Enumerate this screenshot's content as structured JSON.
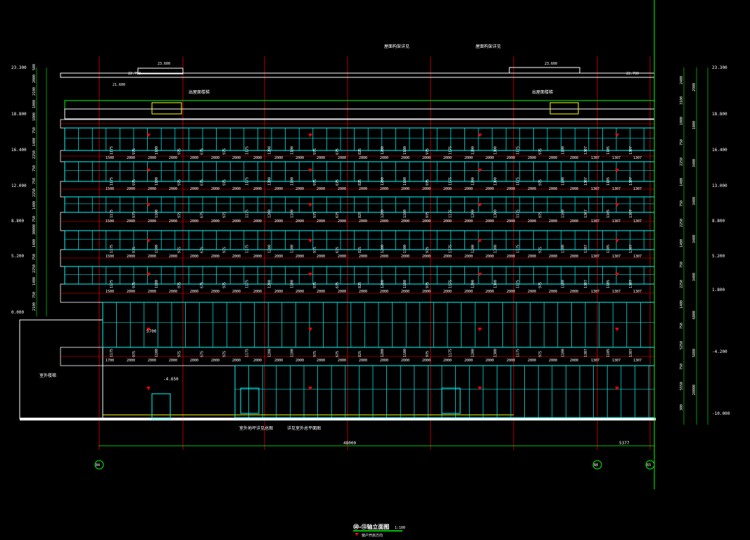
{
  "drawing": {
    "title": "㊿-⑬轴立面图",
    "scale": "1:100",
    "legend_note": "窗户开启方向",
    "overall_dimension": "48000",
    "right_bay_dimension": "5377",
    "axis_labels": [
      "B4",
      "B8",
      "B3"
    ]
  },
  "elevation_marks_left": [
    "23.300",
    "18.800",
    "16.400",
    "12.000",
    "8.800",
    "5.200",
    "0.000"
  ],
  "elevation_marks_right": [
    "23.300",
    "18.800",
    "16.400",
    "13.000",
    "8.800",
    "5.200",
    "1.800",
    "-4.200",
    "-10.000"
  ],
  "roof_marks": [
    "23.600",
    "22.700",
    "21.600",
    "23.600",
    "22.700"
  ],
  "annotations": {
    "top_note_1": "屋面构架详见",
    "top_note_2": "屋面构架详见",
    "roof_label_left": "出屋面楼梯",
    "roof_label_right": "出屋面楼梯",
    "left_block": "室外楼梯",
    "level_mark": "-4.650",
    "span_note": "5700",
    "bottom_note_1": "室外地坪详见总图",
    "bottom_note_2": "详见室外总平面图"
  },
  "dims": {
    "left_col": [
      "500",
      "2000",
      "2100",
      "1000",
      "1000",
      "750",
      "1400",
      "2250",
      "750",
      "750",
      "2250",
      "1400",
      "750",
      "30000",
      "1400",
      "750",
      "2250",
      "1400",
      "750",
      "2100"
    ],
    "right_col_a": [
      "2400",
      "3100",
      "1000",
      "750",
      "2250",
      "1400",
      "750",
      "2250",
      "1400",
      "750",
      "2250",
      "1400",
      "750",
      "5250",
      "750",
      "5550",
      "300"
    ],
    "right_col_b": [
      "2900",
      "1000",
      "3400",
      "3400",
      "3400",
      "3400",
      "6000",
      "5800",
      "28000"
    ],
    "bay_row_a": [
      "1500",
      "2000",
      "2000",
      "2000",
      "2000",
      "2000",
      "2000",
      "2000",
      "2000",
      "2000",
      "2000",
      "2000",
      "2000",
      "2000",
      "2000",
      "2000",
      "2000",
      "2000",
      "2000",
      "2000",
      "2000",
      "2000",
      "2000",
      "1307",
      "1307",
      "1307"
    ],
    "bay_row_b": [
      "1700",
      "2000",
      "2000",
      "2000",
      "2000",
      "2000",
      "2000",
      "2000",
      "2000",
      "2000",
      "2000",
      "2000",
      "2000",
      "2000",
      "2000",
      "2000",
      "2000",
      "2000",
      "2000",
      "2000",
      "2000",
      "2000",
      "2000",
      "1307",
      "1307",
      "1307"
    ],
    "notch_values": [
      "1175",
      "975",
      "1100",
      "975",
      "675",
      "975",
      "1175",
      "1200",
      "1100",
      "975",
      "675",
      "825",
      "1200",
      "1100",
      "975",
      "1175",
      "1200",
      "1300",
      "1175",
      "975",
      "1100",
      "1307",
      "1105",
      "1307"
    ]
  },
  "colors": {
    "background": "#000000",
    "curtain_wall": "#00ffff",
    "frame": "#ffffff",
    "axis": "#ff0000",
    "roof_green": "#00ff00",
    "arrow_red": "#ff0000",
    "ground": "#ffffff",
    "level_yellow": "#ffff00"
  }
}
